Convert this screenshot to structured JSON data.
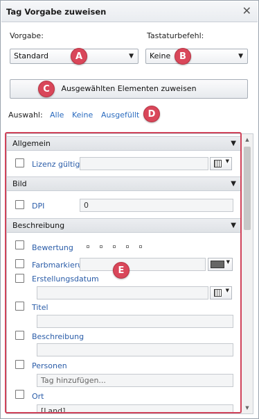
{
  "dialog": {
    "title": "Tag Vorgabe zuweisen",
    "close_glyph": "✕"
  },
  "vorgabe": {
    "label": "Vorgabe:",
    "value": "Standard"
  },
  "tastatur": {
    "label": "Tastaturbefehl:",
    "value": "Keine"
  },
  "assign_button": "Ausgewählten Elementen zuweisen",
  "auswahl": {
    "label": "Auswahl:",
    "all": "Alle",
    "none": "Keine",
    "filled": "Ausgefüllt"
  },
  "badges": {
    "a": "A",
    "b": "B",
    "c": "C",
    "d": "D",
    "e": "E"
  },
  "sections": {
    "allgemein": "Allgemein",
    "bild": "Bild",
    "beschreibung": "Beschreibung"
  },
  "fields": {
    "lizenz": {
      "label": "Lizenz gültig",
      "value": ""
    },
    "dpi": {
      "label": "DPI",
      "value": "0"
    },
    "bewertung": {
      "label": "Bewertung"
    },
    "farbmarkierung": {
      "label": "Farbmarkieru"
    },
    "erstellungsdatum": {
      "label": "Erstellungsdatum",
      "value": ""
    },
    "titel": {
      "label": "Titel",
      "value": ""
    },
    "beschreibung": {
      "label": "Beschreibung",
      "value": ""
    },
    "personen": {
      "label": "Personen",
      "placeholder": "Tag hinzufügen..."
    },
    "ort": {
      "label": "Ort",
      "value": "[Land]"
    }
  },
  "icons": {
    "dropdown": "chevron-down",
    "calendar": "calendar-icon",
    "color": "color-swatch"
  },
  "colors": {
    "accent_red": "#d0435a",
    "link_blue": "#2a6bbf",
    "swatch": "#666666"
  }
}
